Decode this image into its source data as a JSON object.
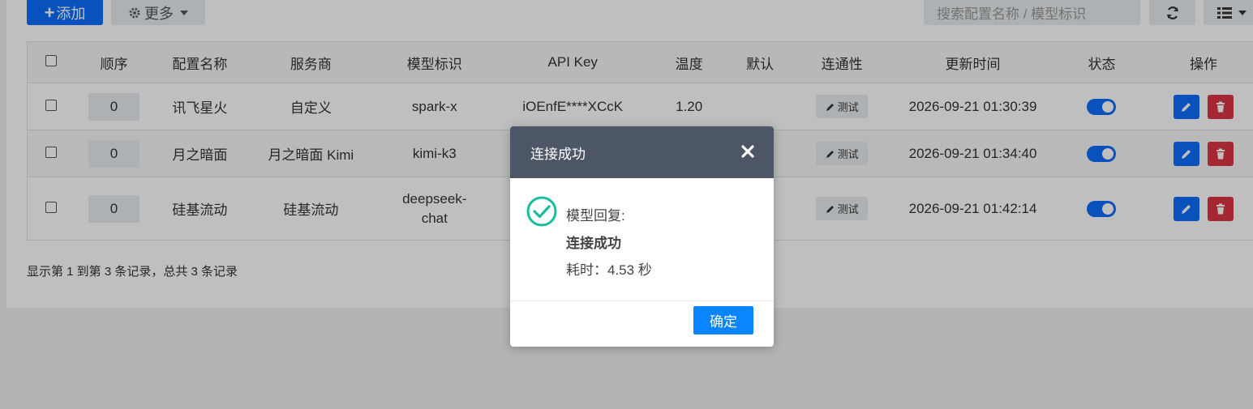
{
  "toolbar": {
    "add_label": "添加",
    "more_label": "更多",
    "search_placeholder": "搜索配置名称 / 模型标识"
  },
  "table": {
    "headers": [
      "顺序",
      "配置名称",
      "服务商",
      "模型标识",
      "API Key",
      "温度",
      "默认",
      "连通性",
      "更新时间",
      "状态",
      "操作"
    ],
    "rows": [
      {
        "order": "0",
        "name": "讯飞星火",
        "provider": "自定义",
        "model": "spark-x",
        "api_key": "iOEnfE****XCcK",
        "temperature": "1.20",
        "default": "",
        "test_label": "测试",
        "updated": "2026-09-21 01:30:39",
        "enabled": true
      },
      {
        "order": "0",
        "name": "月之暗面",
        "provider": "月之暗面 Kimi",
        "model": "kimi-k3",
        "api_key": "",
        "temperature": "",
        "default": "",
        "test_label": "测试",
        "updated": "2026-09-21 01:34:40",
        "enabled": true
      },
      {
        "order": "0",
        "name": "硅基流动",
        "provider": "硅基流动",
        "model_line1": "deepseek-",
        "model_line2": "chat",
        "api_key": "",
        "temperature": "",
        "default": "",
        "test_label": "测试",
        "updated": "2026-09-21 01:42:14",
        "enabled": true
      }
    ]
  },
  "footer": {
    "summary": "显示第 1 到第 3 条记录，总共 3 条记录"
  },
  "modal": {
    "title": "连接成功",
    "reply_label": "模型回复:",
    "reply_text": "连接成功",
    "elapsed": "耗时：4.53 秒",
    "ok_label": "确定"
  },
  "colors": {
    "primary": "#0d6efd",
    "danger": "#dc3545",
    "modal_header": "#4d5666",
    "success": "#1abc9c"
  }
}
